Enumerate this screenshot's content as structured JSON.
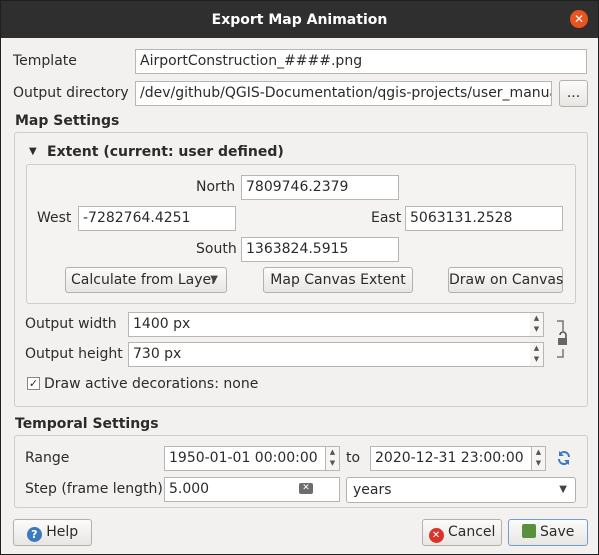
{
  "window": {
    "title": "Export Map Animation",
    "close_glyph": "✕"
  },
  "template": {
    "label": "Template",
    "value": "AirportConstruction_####.png"
  },
  "output_directory": {
    "label": "Output directory",
    "value": "/dev/github/QGIS-Documentation/qgis-projects/user_manual",
    "browse_label": "..."
  },
  "map_settings": {
    "title": "Map Settings",
    "extent": {
      "title": "Extent (current: user defined)",
      "north_label": "North",
      "north": "7809746.2379",
      "west_label": "West",
      "west": "-7282764.4251",
      "east_label": "East",
      "east": "5063131.2528",
      "south_label": "South",
      "south": "1363824.5915",
      "calculate_label": "Calculate from Layer",
      "canvas_extent_label": "Map Canvas Extent",
      "draw_label": "Draw on Canvas"
    },
    "output_width_label": "Output width",
    "output_width": "1400 px",
    "output_height_label": "Output height",
    "output_height": "730 px",
    "decorations_label": "Draw active decorations: none",
    "decorations_checked": true
  },
  "temporal_settings": {
    "title": "Temporal Settings",
    "range_label": "Range",
    "range_start": "1950-01-01 00:00:00",
    "to_label": "to",
    "range_end": "2020-12-31 23:00:00",
    "step_label": "Step (frame length)",
    "step_value": "5.000",
    "step_unit": "years"
  },
  "buttons": {
    "help": "Help",
    "cancel": "Cancel",
    "save": "Save"
  },
  "colors": {
    "titlebar": "#2f2f2f",
    "close": "#e95420",
    "save_border": "#6f9fcf"
  }
}
